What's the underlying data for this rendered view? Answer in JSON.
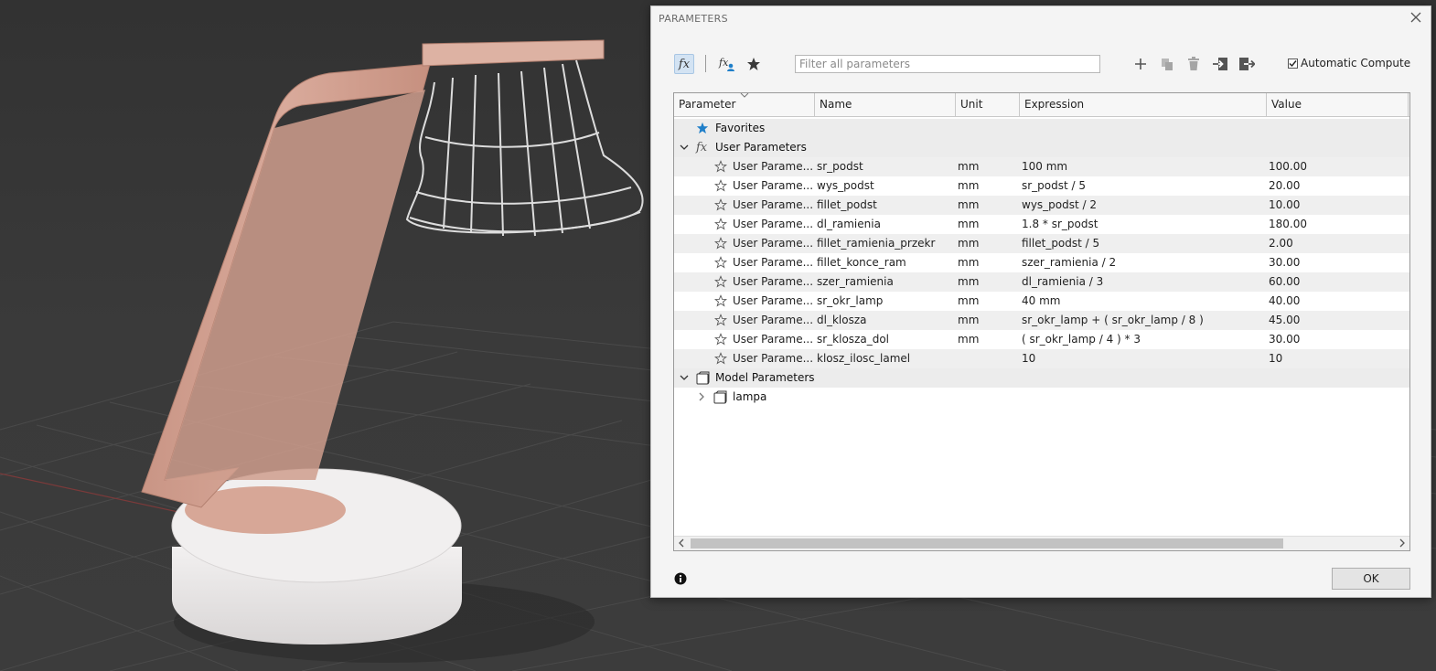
{
  "dialog": {
    "title": "PARAMETERS",
    "filter_placeholder": "Filter all parameters",
    "auto_compute_label": "Automatic Compute",
    "auto_compute_checked": true,
    "ok_label": "OK"
  },
  "table": {
    "columns": [
      "Parameter",
      "Name",
      "Unit",
      "Expression",
      "Value"
    ],
    "favorites_label": "Favorites",
    "user_group_label": "User Parameters",
    "model_group_label": "Model Parameters",
    "model_child_label": "lampa",
    "rows": [
      {
        "param": "User Parame...",
        "name": "sr_podst",
        "unit": "mm",
        "expr": "100 mm",
        "value": "100.00"
      },
      {
        "param": "User Parame...",
        "name": "wys_podst",
        "unit": "mm",
        "expr": "sr_podst / 5",
        "value": "20.00"
      },
      {
        "param": "User Parame...",
        "name": "fillet_podst",
        "unit": "mm",
        "expr": "wys_podst / 2",
        "value": "10.00"
      },
      {
        "param": "User Parame...",
        "name": "dl_ramienia",
        "unit": "mm",
        "expr": "1.8 * sr_podst",
        "value": "180.00"
      },
      {
        "param": "User Parame...",
        "name": "fillet_ramienia_przekr",
        "unit": "mm",
        "expr": "fillet_podst / 5",
        "value": "2.00"
      },
      {
        "param": "User Parame...",
        "name": "fillet_konce_ram",
        "unit": "mm",
        "expr": "szer_ramienia / 2",
        "value": "30.00"
      },
      {
        "param": "User Parame...",
        "name": "szer_ramienia",
        "unit": "mm",
        "expr": "dl_ramienia / 3",
        "value": "60.00"
      },
      {
        "param": "User Parame...",
        "name": "sr_okr_lamp",
        "unit": "mm",
        "expr": "40 mm",
        "value": "40.00"
      },
      {
        "param": "User Parame...",
        "name": "dl_klosza",
        "unit": "mm",
        "expr": "sr_okr_lamp + ( sr_okr_lamp / 8 )",
        "value": "45.00"
      },
      {
        "param": "User Parame...",
        "name": "sr_klosza_dol",
        "unit": "mm",
        "expr": "( sr_okr_lamp / 4 ) * 3",
        "value": "30.00"
      },
      {
        "param": "User Parame...",
        "name": "klosz_ilosc_lamel",
        "unit": "",
        "expr": "10",
        "value": "10"
      }
    ]
  },
  "icons": {
    "fx": "fx-icon",
    "fx_user": "fx-user-icon",
    "favorite": "star-icon",
    "add": "plus-icon",
    "copy": "copy-icon",
    "delete": "trash-icon",
    "import": "import-icon",
    "export": "export-icon",
    "info": "info-icon",
    "close": "close-icon"
  },
  "colors": {
    "favorite_star": "#1f7fc9",
    "arm": "#d9a99a",
    "base": "#e9e6e6",
    "viewport_bg": "#353535"
  }
}
